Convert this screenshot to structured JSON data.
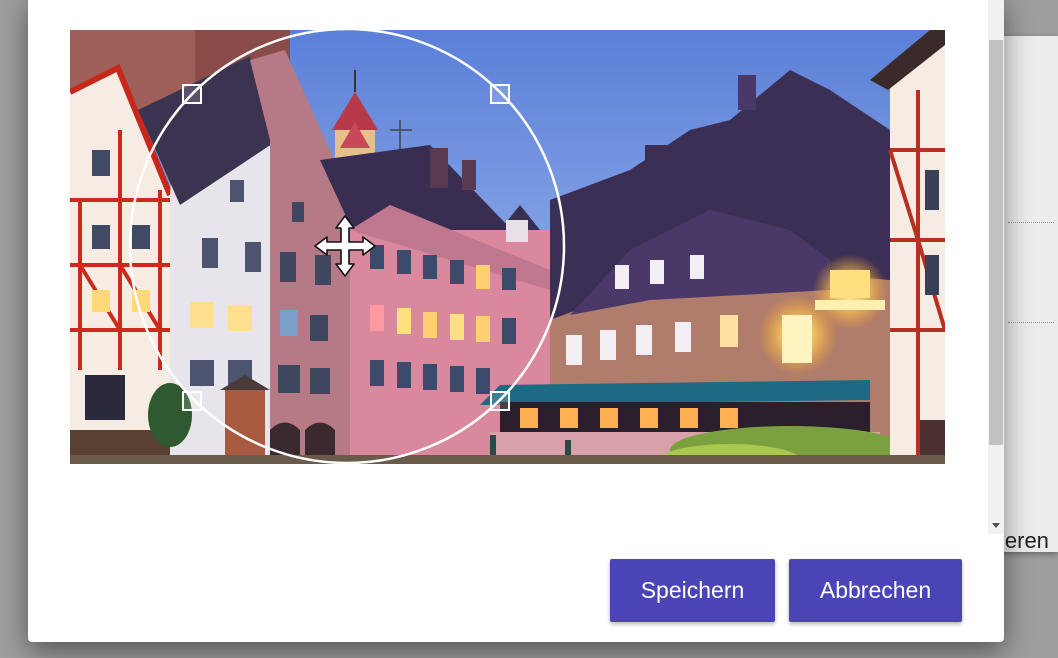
{
  "background": {
    "partial_text": "ieren"
  },
  "dialog": {
    "buttons": {
      "save_label": "Speichern",
      "cancel_label": "Abbrechen"
    },
    "cropper": {
      "shape": "circle",
      "cursor_icon": "move-icon",
      "handle_icon": "resize-handle-icon"
    }
  },
  "colors": {
    "primary": "#4a44b6",
    "sky": "#6f8fe0",
    "roof": "#4a3565"
  }
}
